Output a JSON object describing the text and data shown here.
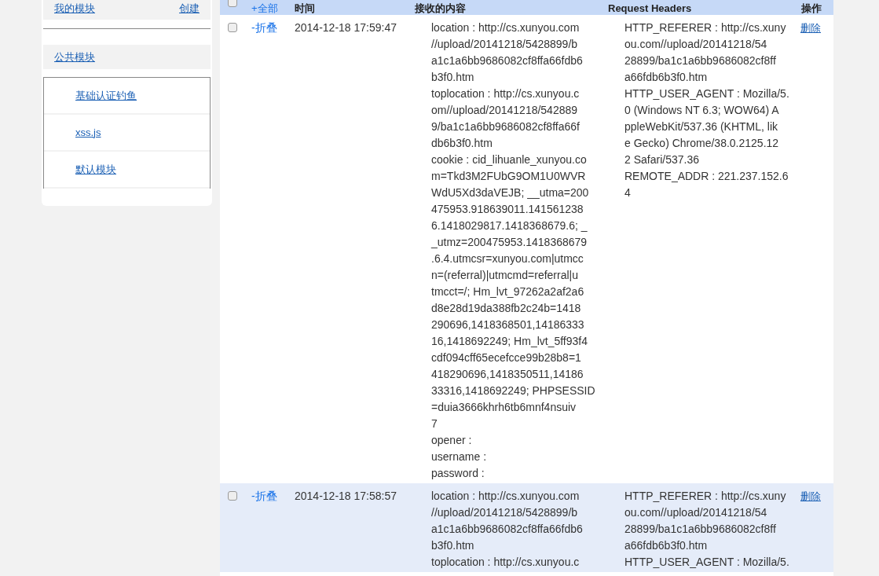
{
  "sidebar": {
    "my_modules": {
      "label": "我的模块",
      "create": "创建"
    },
    "public_modules": {
      "label": "公共模块",
      "items": [
        "基础认证钓鱼",
        "xss.js",
        "默认模块"
      ]
    }
  },
  "table": {
    "select_all": {
      "checked": false
    },
    "columns": [
      "+全部",
      "时间",
      "接收的内容",
      "Request Headers",
      "操作"
    ],
    "rows": [
      {
        "checked": false,
        "selected": false,
        "toggle": "-折叠",
        "time": "2014-12-18 17:59:47",
        "content": [
          "location : http://cs.xunyou.com",
          "//upload/20141218/5428899/b",
          "a1c1a6bb9686082cf8ffa66fdb6",
          "b3f0.htm",
          "toplocation : http://cs.xunyou.c",
          "om//upload/20141218/542889",
          "9/ba1c1a6bb9686082cf8ffa66f",
          "db6b3f0.htm",
          "cookie : cid_lihuanle_xunyou.co",
          "m=Tkd3M2FUbG9OM1U0WVR",
          "WdU5Xd3daVEJB; __utma=200",
          "475953.918639011.141561238",
          "6.1418029817.1418368679.6; _",
          "_utmz=200475953.1418368679",
          ".6.4.utmcsr=xunyou.com|utmcc",
          "n=(referral)|utmcmd=referral|u",
          "tmcct=/; Hm_lvt_97262a2af2a6",
          "d8e28d19da388fb2c24b=1418",
          "290696,1418368501,14186333",
          "16,1418692249; Hm_lvt_5ff93f4",
          "cdf094cff65ecefcce99b28b8=1",
          "418290696,1418350511,14186",
          "33316,1418692249; PHPSESSID",
          "=duia3666khrh6tb6mnf4nsuiv",
          "7",
          "opener :",
          "username :",
          "password :"
        ],
        "headers": [
          "HTTP_REFERER : http://cs.xuny",
          "ou.com//upload/20141218/54",
          "28899/ba1c1a6bb9686082cf8ff",
          "a66fdb6b3f0.htm",
          "HTTP_USER_AGENT : Mozilla/5.",
          "0 (Windows NT 6.3; WOW64) A",
          "ppleWebKit/537.36 (KHTML, lik",
          "e Gecko) Chrome/38.0.2125.12",
          "2 Safari/537.36",
          "REMOTE_ADDR : 221.237.152.6",
          "4"
        ],
        "action": "删除"
      },
      {
        "checked": false,
        "selected": true,
        "toggle": "-折叠",
        "time": "2014-12-18 17:58:57",
        "content": [
          "location : http://cs.xunyou.com",
          "//upload/20141218/5428899/b",
          "a1c1a6bb9686082cf8ffa66fdb6",
          "b3f0.htm",
          "toplocation : http://cs.xunyou.c"
        ],
        "headers": [
          "HTTP_REFERER : http://cs.xuny",
          "ou.com//upload/20141218/54",
          "28899/ba1c1a6bb9686082cf8ff",
          "a66fdb6b3f0.htm",
          "HTTP_USER_AGENT : Mozilla/5."
        ],
        "action": "删除"
      }
    ]
  }
}
